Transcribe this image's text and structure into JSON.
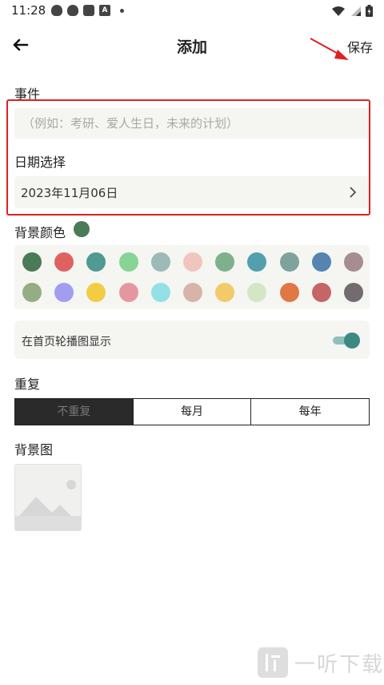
{
  "status_bar": {
    "time": "11:28",
    "a_badge": "A"
  },
  "header": {
    "title": "添加",
    "save_label": "保存"
  },
  "event": {
    "label": "事件",
    "placeholder": "（例如：考研、爱人生日，未来的计划）",
    "value": ""
  },
  "date": {
    "label": "日期选择",
    "value": "2023年11月06日"
  },
  "background_color": {
    "label": "背景颜色",
    "selected": "#4a7a56",
    "palette": [
      [
        "#4a7a56",
        "#de6360",
        "#4f9a92",
        "#88d396",
        "#9bbab8",
        "#f1c4bd",
        "#7eb08c",
        "#52a0ad",
        "#7fa29c",
        "#5584b1",
        "#a68d92"
      ],
      [
        "#93ae84",
        "#a29df0",
        "#f2cd43",
        "#e597a0",
        "#93e1e6",
        "#d6b5a8",
        "#f2cb68",
        "#d3e7c7",
        "#e17745",
        "#c56567",
        "#736b70"
      ]
    ]
  },
  "carousel": {
    "label": "在首页轮播图显示",
    "enabled": true,
    "accent": "#3d8a82"
  },
  "repeat": {
    "label": "重复",
    "options": [
      "不重复",
      "每月",
      "每年"
    ],
    "selected": 0
  },
  "background_image": {
    "label": "背景图"
  },
  "watermark": {
    "text": "一听下载"
  }
}
